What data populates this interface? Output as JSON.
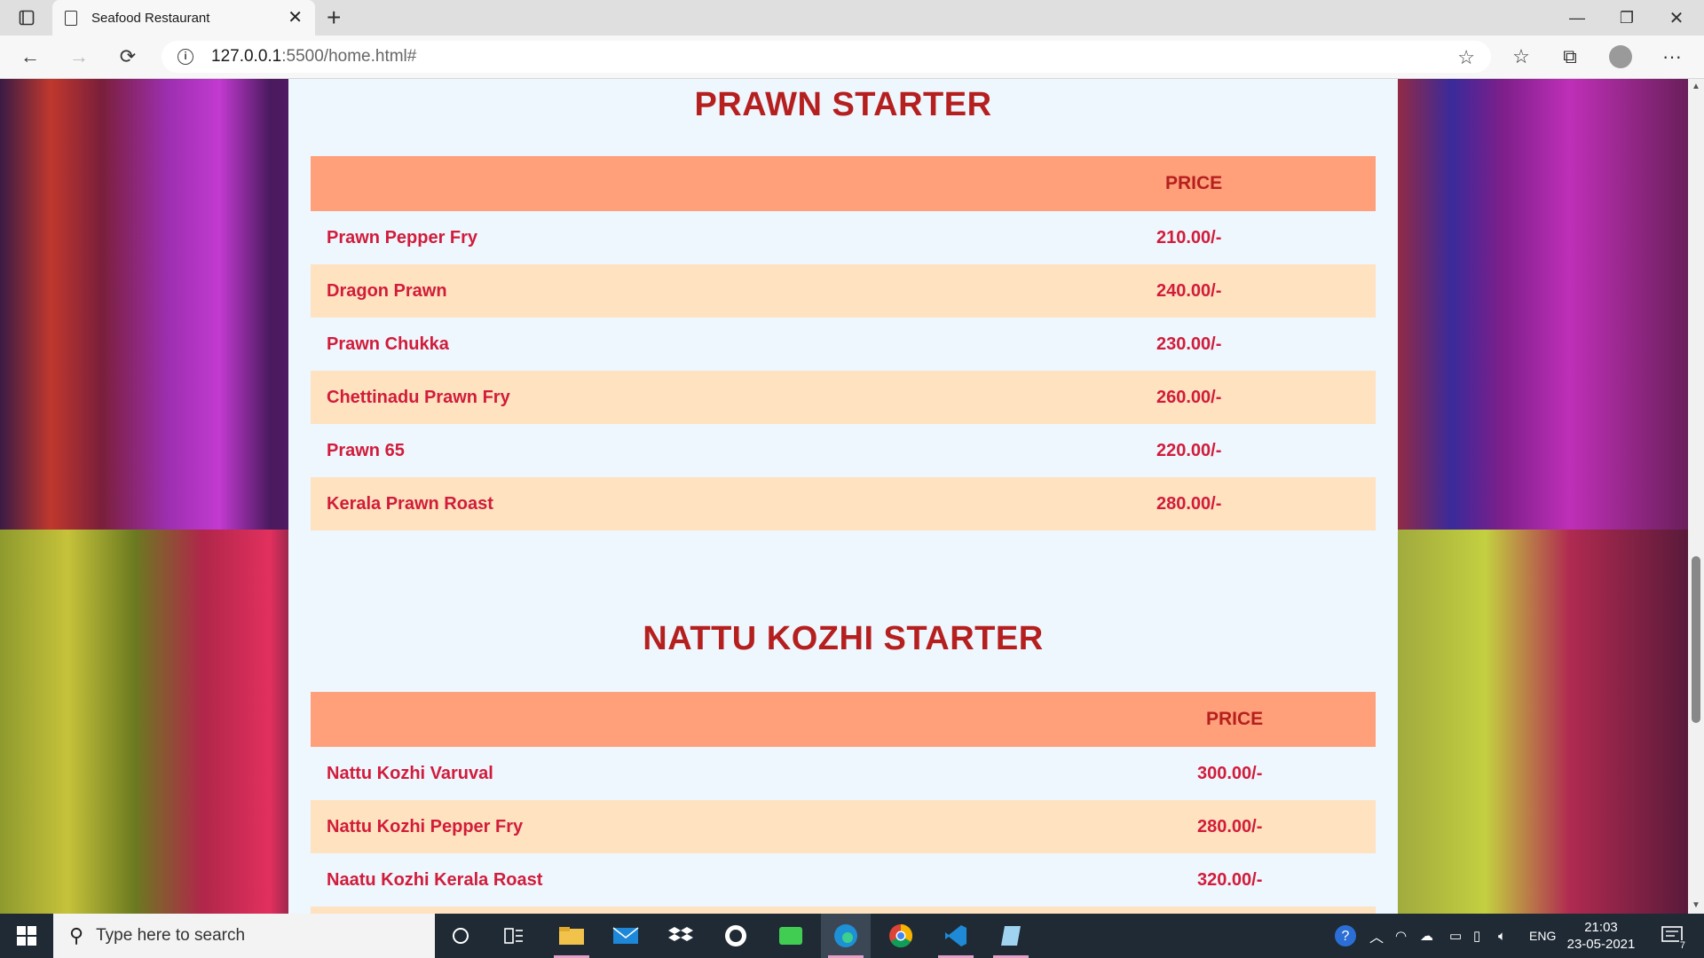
{
  "browser": {
    "tab_title": "Seafood Restaurant",
    "url_host": "127.0.0.1",
    "url_rest": ":5500/home.html#"
  },
  "sections": [
    {
      "title": "PRAWN STARTER",
      "price_header": "PRICE",
      "items": [
        {
          "name": "Prawn Pepper Fry",
          "price": "210.00/-"
        },
        {
          "name": "Dragon Prawn",
          "price": "240.00/-"
        },
        {
          "name": "Prawn Chukka",
          "price": "230.00/-"
        },
        {
          "name": "Chettinadu Prawn Fry",
          "price": "260.00/-"
        },
        {
          "name": "Prawn 65",
          "price": "220.00/-"
        },
        {
          "name": "Kerala Prawn Roast",
          "price": "280.00/-"
        }
      ]
    },
    {
      "title": "NATTU KOZHI STARTER",
      "price_header": "PRICE",
      "items": [
        {
          "name": "Nattu Kozhi Varuval",
          "price": "300.00/-"
        },
        {
          "name": "Nattu Kozhi Pepper Fry",
          "price": "280.00/-"
        },
        {
          "name": "Naatu Kozhi Kerala Roast",
          "price": "320.00/-"
        }
      ]
    }
  ],
  "taskbar": {
    "search_placeholder": "Type here to search",
    "language": "ENG",
    "time": "21:03",
    "date": "23-05-2021",
    "notification_count": "7"
  },
  "colors": {
    "title_red": "#b5201f",
    "item_red": "#d11c3a",
    "header_bg": "#ffa07a",
    "alt_row_bg": "#ffe2c0",
    "content_bg": "#eef6fe"
  }
}
